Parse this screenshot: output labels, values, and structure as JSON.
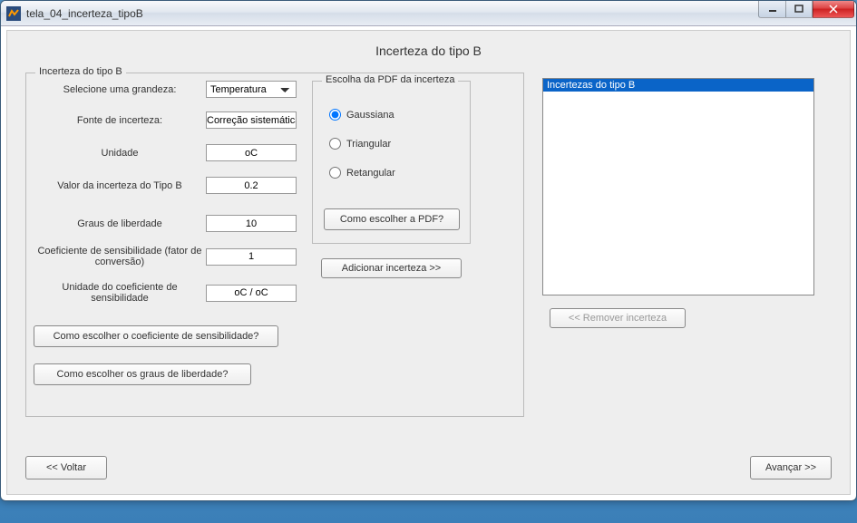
{
  "window": {
    "title": "tela_04_incerteza_tipoB"
  },
  "page": {
    "heading": "Incerteza do tipo B"
  },
  "group": {
    "main_legend": "Incerteza do tipo B",
    "pdf_legend": "Escolha da PDF da incerteza"
  },
  "labels": {
    "grandeza": "Selecione uma grandeza:",
    "fonte": "Fonte de incerteza:",
    "unidade": "Unidade",
    "valor": "Valor da incerteza do Tipo B",
    "graus": "Graus de liberdade",
    "coef": "Coeficiente de sensibilidade (fator de conversão)",
    "coef_unid": "Unidade do coeficiente de sensibilidade"
  },
  "fields": {
    "grandeza_selected": "Temperatura",
    "fonte": "Correção sistemática",
    "unidade": "oC",
    "valor": "0.2",
    "graus": "10",
    "coef": "1",
    "coef_unid": "oC / oC"
  },
  "pdf": {
    "gaussiana": "Gaussiana",
    "triangular": "Triangular",
    "retangular": "Retangular",
    "selected": "gaussiana",
    "help_btn": "Como escolher a PDF?"
  },
  "buttons": {
    "add": "Adicionar incerteza >>",
    "remove": "<< Remover incerteza",
    "help_coef": "Como escolher o coeficiente de sensibilidade?",
    "help_graus": "Como escolher os graus de liberdade?",
    "back": "<< Voltar",
    "next": "Avançar >>"
  },
  "list": {
    "items": [
      "Incertezas do tipo B"
    ],
    "selected_index": 0
  }
}
